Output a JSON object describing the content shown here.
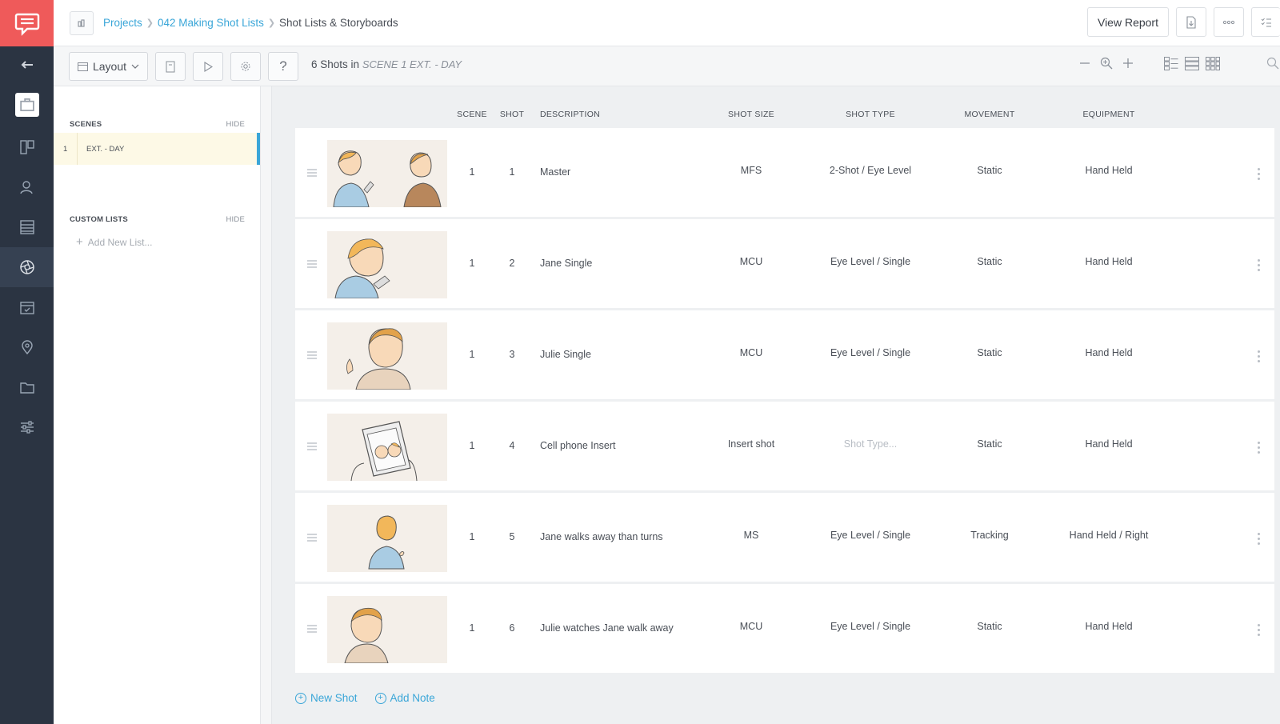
{
  "breadcrumb": {
    "items": [
      "Projects",
      "042 Making Shot Lists"
    ],
    "current": "Shot Lists & Storyboards"
  },
  "header": {
    "view_report_label": "View Report"
  },
  "toolbar": {
    "layout_label": "Layout",
    "shot_count": "6 Shots in",
    "scene_label": "SCENE 1 EXT. - DAY"
  },
  "sidebar": {
    "scenes_title": "SCENES",
    "scenes_hide": "HIDE",
    "scenes": [
      {
        "number": "1",
        "name": "EXT. - DAY"
      }
    ],
    "custom_title": "CUSTOM LISTS",
    "custom_hide": "HIDE",
    "add_list_label": "Add New List..."
  },
  "columns": {
    "scene": "SCENE",
    "shot": "SHOT",
    "description": "DESCRIPTION",
    "shot_size": "SHOT SIZE",
    "shot_type": "SHOT TYPE",
    "movement": "MOVEMENT",
    "equipment": "EQUIPMENT"
  },
  "shot_type_placeholder": "Shot Type...",
  "shots": [
    {
      "scene": "1",
      "shot": "1",
      "description": "Master",
      "shot_size": "MFS",
      "shot_type": "2-Shot / Eye Level",
      "movement": "Static",
      "equipment": "Hand Held"
    },
    {
      "scene": "1",
      "shot": "2",
      "description": "Jane Single",
      "shot_size": "MCU",
      "shot_type": "Eye Level / Single",
      "movement": "Static",
      "equipment": "Hand Held"
    },
    {
      "scene": "1",
      "shot": "3",
      "description": "Julie Single",
      "shot_size": "MCU",
      "shot_type": "Eye Level / Single",
      "movement": "Static",
      "equipment": "Hand Held"
    },
    {
      "scene": "1",
      "shot": "4",
      "description": "Cell phone Insert",
      "shot_size": "Insert shot",
      "shot_type": "",
      "movement": "Static",
      "equipment": "Hand Held"
    },
    {
      "scene": "1",
      "shot": "5",
      "description": "Jane walks away than turns",
      "shot_size": "MS",
      "shot_type": "Eye Level / Single",
      "movement": "Tracking",
      "equipment": "Hand Held / Right"
    },
    {
      "scene": "1",
      "shot": "6",
      "description": "Julie watches Jane walk away",
      "shot_size": "MCU",
      "shot_type": "Eye Level / Single",
      "movement": "Static",
      "equipment": "Hand Held"
    }
  ],
  "footer": {
    "new_shot_label": "New Shot",
    "add_note_label": "Add Note"
  },
  "colors": {
    "brand": "#ef5a5a",
    "accent": "#3aa6d8",
    "rail": "#2b3442",
    "selected_scene": "#fdf9e6"
  },
  "icons": {
    "rail": [
      "chat-bubble-icon",
      "back-arrow-icon",
      "briefcase-icon",
      "storyboard-icon",
      "contacts-icon",
      "stripboard-icon",
      "aperture-icon",
      "calendar-icon",
      "location-pin-icon",
      "folder-icon",
      "sliders-icon"
    ],
    "toolbar": [
      "layout-icon",
      "bookmark-icon",
      "play-icon",
      "gear-icon",
      "help-icon",
      "zoom-out-icon",
      "zoom-icon",
      "zoom-in-icon",
      "grid-view-icon",
      "list-view-icon",
      "thumbnail-view-icon",
      "search-icon"
    ]
  }
}
